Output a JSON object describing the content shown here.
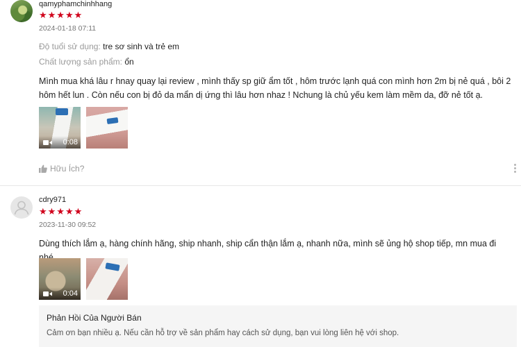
{
  "reviews": [
    {
      "username": "qamyphamchinhhang",
      "stars": "★★★★★",
      "timestamp": "2024-01-18 07:11",
      "age_label": "Độ tuổi sử dụng:",
      "age_value": "tre sơ sinh và trẻ em",
      "quality_label": "Chất lượng sản phẩm:",
      "quality_value": "ổn",
      "comment": "Mình mua khá lâu r hnay quay lại review , mình thấy sp giữ ẩm tốt , hôm trước lạnh quá con mình hơn 2m bị nẻ quá , bôi 2 hôm hết lun . Còn nếu con bị đỏ da mẩn dị ứng thì lâu hơn nhaz ! Nchung là chủ yếu kem làm mềm da, đỡ nẻ tốt ạ.",
      "video_duration": "0:08",
      "helpful_label": "Hữu Ích?"
    },
    {
      "username": "cdry971",
      "stars": "★★★★★",
      "timestamp": "2023-11-30 09:52",
      "comment": "Dùng thích lắm ạ, hàng chính hãng, ship nhanh, ship cẩn thận lắm ạ, nhanh nữa, mình sẽ ủng hộ shop tiếp, mn mua đi nhé",
      "video_duration": "0:04",
      "seller_reply_title": "Phản Hồi Của Người Bán",
      "seller_reply_text": "Cảm ơn bạn nhiều ạ. Nếu cần hỗ trợ về sản phẩm hay cách sử dụng, bạn vui lòng liên hệ với shop."
    }
  ],
  "colors": {
    "star": "#d0011b",
    "muted": "#9a9a9a",
    "reply_bg": "#f5f5f5"
  },
  "icons": [
    "user-avatar-icon",
    "video-camera-icon",
    "thumbs-up-icon",
    "more-vertical-icon"
  ]
}
